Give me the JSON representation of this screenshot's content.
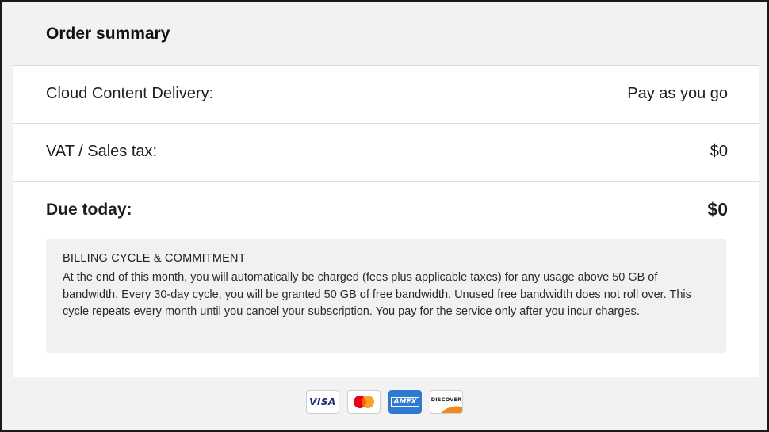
{
  "header": {
    "title": "Order summary"
  },
  "rows": [
    {
      "label": "Cloud Content Delivery:",
      "value": "Pay as you go"
    },
    {
      "label": "VAT / Sales tax:",
      "value": "$0"
    }
  ],
  "due": {
    "label": "Due today:",
    "value": "$0"
  },
  "notice": {
    "title": "BILLING CYCLE & COMMITMENT",
    "text": "At the end of this month, you will automatically be charged (fees plus applicable taxes) for any usage above 50 GB of bandwidth. Every 30-day cycle, you will be granted 50 GB of free bandwidth. Unused free bandwidth does not roll over. This cycle repeats every month until you cancel your subscription. You pay for the service only after you incur charges."
  },
  "payment_cards": [
    {
      "icon": "visa-card-icon",
      "text": "VISA"
    },
    {
      "icon": "mastercard-card-icon",
      "text": ""
    },
    {
      "icon": "amex-card-icon",
      "text": "AMEX"
    },
    {
      "icon": "discover-card-icon",
      "text": "DISCOVER"
    }
  ],
  "colors": {
    "panel_bg": "#f2f2f2",
    "card_bg": "#ffffff",
    "notice_bg": "#f1f1f1",
    "amex_blue": "#2f7ad1",
    "mastercard_red": "#eb001b",
    "mastercard_orange": "#f79e1b",
    "discover_orange": "#f08a1c"
  }
}
